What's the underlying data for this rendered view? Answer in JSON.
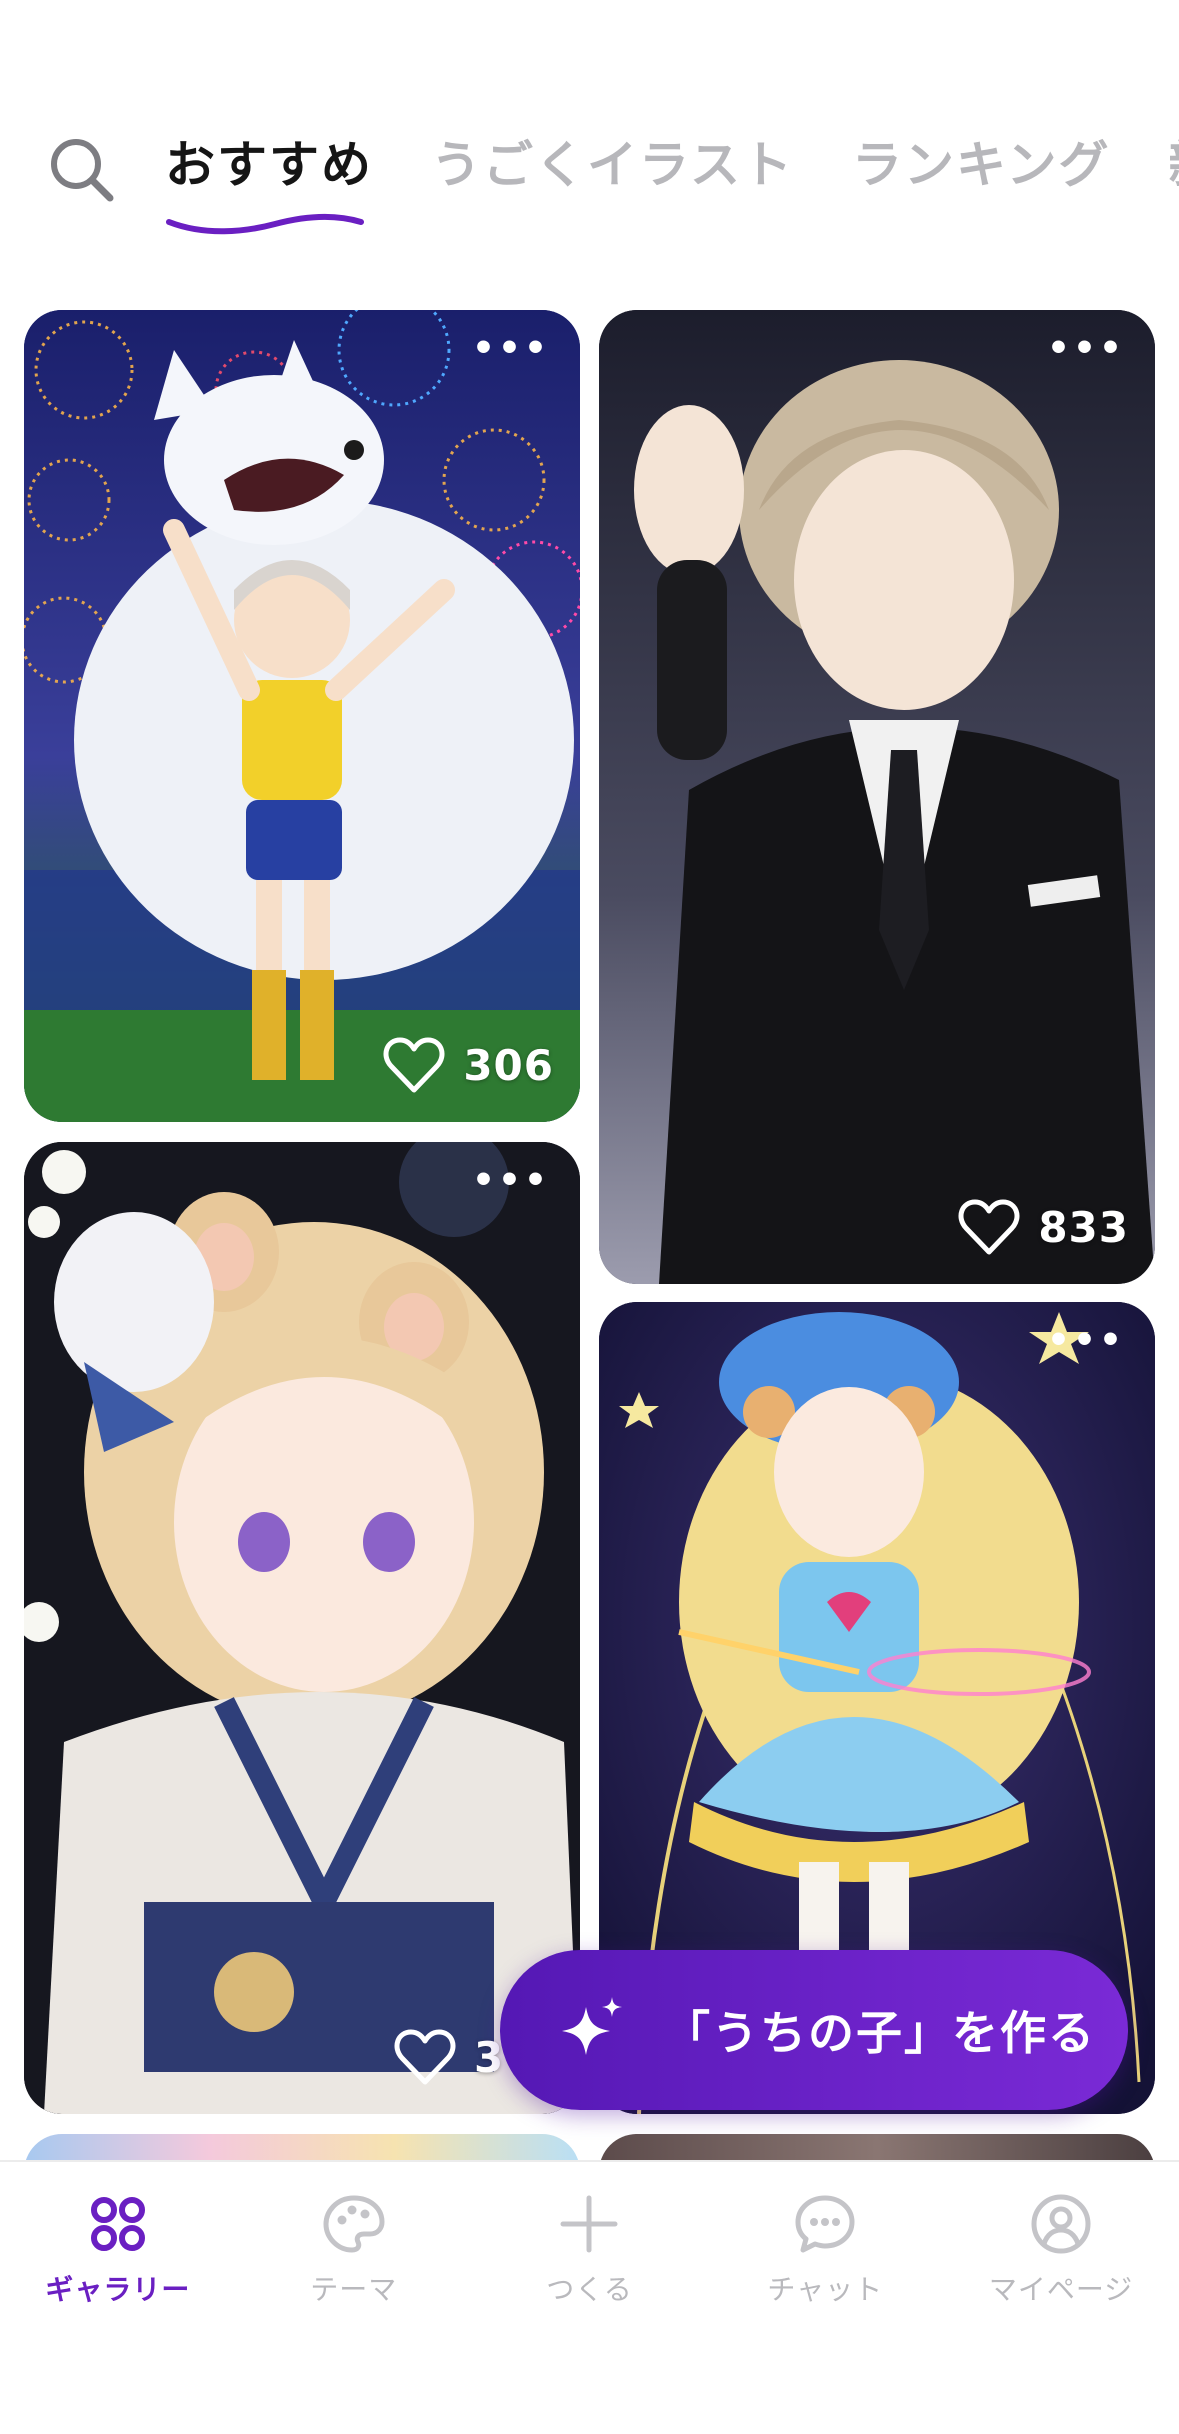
{
  "tabs": {
    "items": [
      {
        "label": "おすすめ",
        "active": true
      },
      {
        "label": "うごくイラスト",
        "active": false
      },
      {
        "label": "ランキング",
        "active": false
      },
      {
        "label": "新",
        "active": false
      }
    ]
  },
  "search": {
    "icon": "search-icon"
  },
  "gallery": {
    "cards": [
      {
        "likes": "306",
        "subject": "girl in soccer jersey with white wolf and fireworks"
      },
      {
        "likes": "833",
        "subject": "man in black suit under crescent moon"
      },
      {
        "likes": "3",
        "subject": "bear-eared girl in kimono with white flowers"
      },
      {
        "likes": "",
        "subject": "magical girl with star wand"
      }
    ]
  },
  "cta": {
    "label": "「うちの子」を作る",
    "icon": "sparkle-icon"
  },
  "bottom_nav": {
    "items": [
      {
        "label": "ギャラリー",
        "icon": "gallery-grid-icon",
        "active": true
      },
      {
        "label": "テーマ",
        "icon": "palette-icon",
        "active": false
      },
      {
        "label": "つくる",
        "icon": "plus-icon",
        "active": false
      },
      {
        "label": "チャット",
        "icon": "chat-bubble-icon",
        "active": false
      },
      {
        "label": "マイページ",
        "icon": "user-profile-icon",
        "active": false
      }
    ]
  },
  "colors": {
    "accent": "#6a1fc2",
    "inactive": "#b9b9bd",
    "active_tab_text": "#151515"
  }
}
